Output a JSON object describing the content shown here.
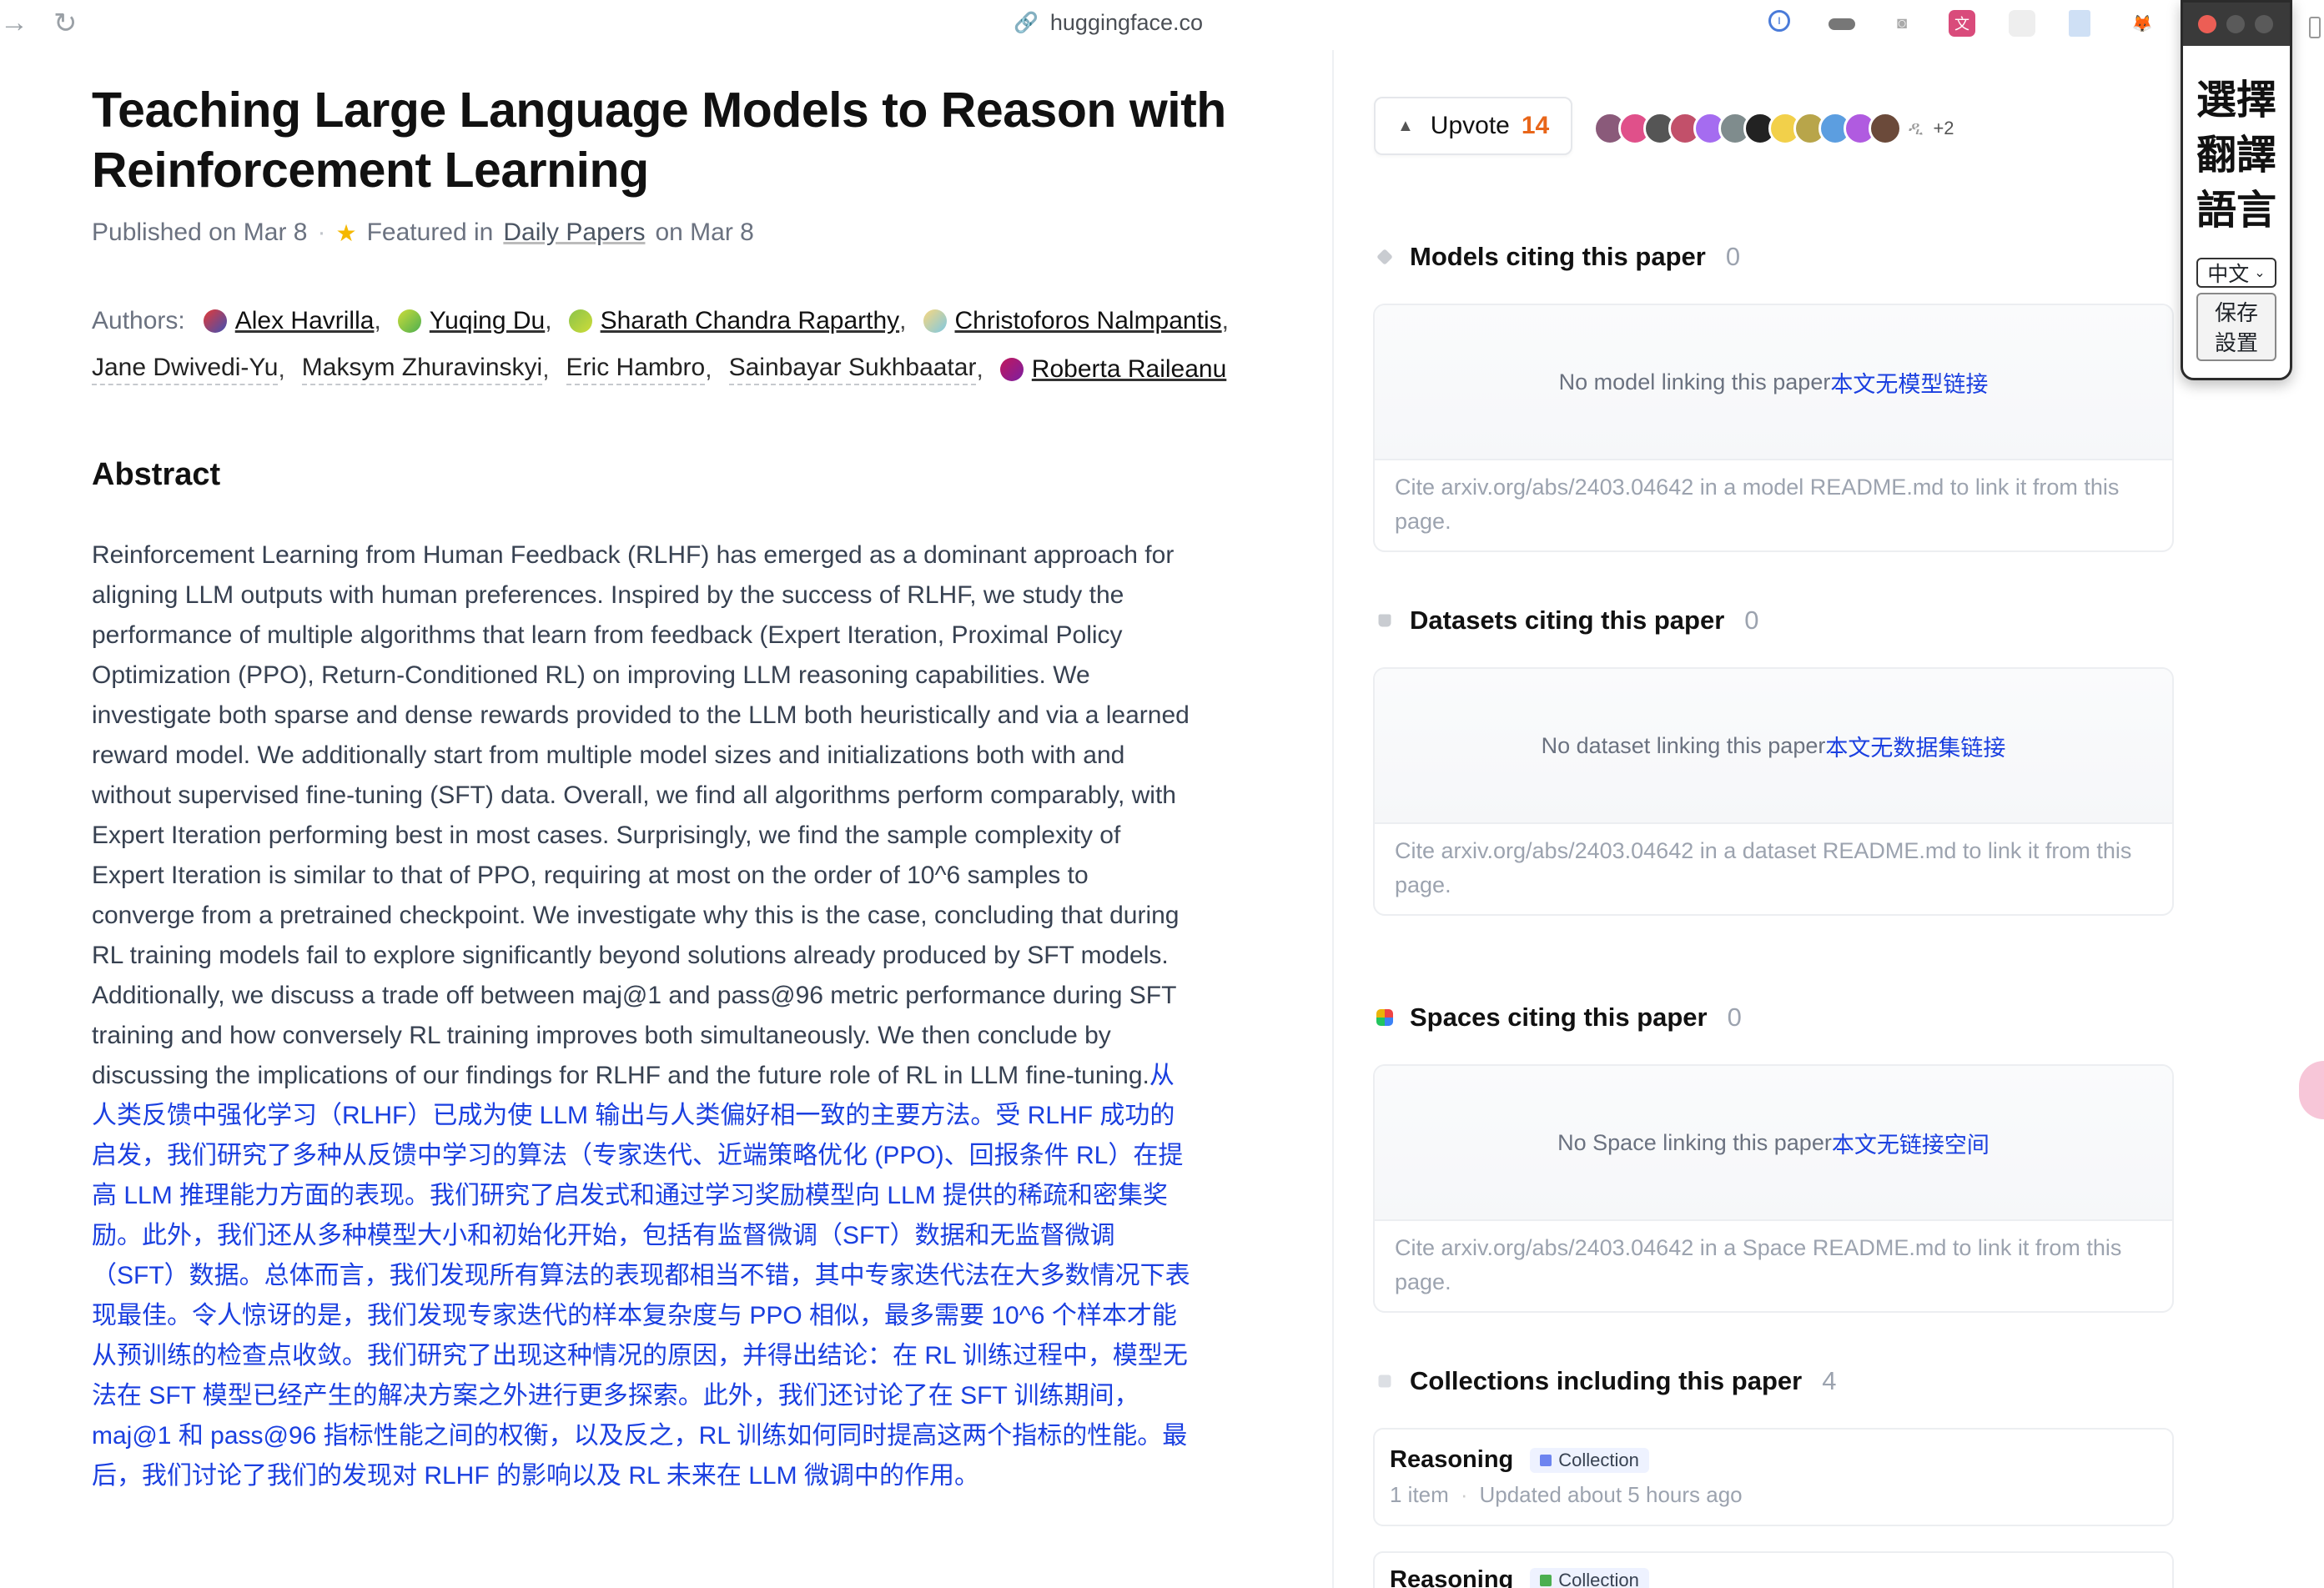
{
  "browser": {
    "url": "huggingface.co",
    "back_icon": "arrow-right-icon",
    "reload_icon": "reload-icon"
  },
  "paper": {
    "title": "Teaching Large Language Models to Reason with Reinforcement Learning",
    "published": "Published on Mar 8",
    "featured_prefix": "Featured in",
    "featured_link": "Daily Papers",
    "featured_suffix": "on Mar 8",
    "authors_label": "Authors:",
    "authors": [
      {
        "name": "Alex Havrilla",
        "linked": true,
        "color": "#5b6ef5"
      },
      {
        "name": "Yuqing Du",
        "linked": true,
        "color": "#8bc34a"
      },
      {
        "name": "Sharath Chandra Raparthy",
        "linked": true,
        "color": "#9ccc65"
      },
      {
        "name": "Christoforos Nalmpantis",
        "linked": true,
        "color": "#7ec8e3"
      },
      {
        "name": "Jane Dwivedi-Yu",
        "linked": false
      },
      {
        "name": "Maksym Zhuravinskyi",
        "linked": false
      },
      {
        "name": "Eric Hambro",
        "linked": false
      },
      {
        "name": "Sainbayar Sukhbaatar",
        "linked": false
      },
      {
        "name": "Roberta Raileanu",
        "linked": true,
        "color": "#c2185b"
      }
    ],
    "abstract_heading": "Abstract",
    "abstract_en": "Reinforcement Learning from Human Feedback (RLHF) has emerged as a dominant approach for aligning LLM outputs with human preferences. Inspired by the success of RLHF, we study the performance of multiple algorithms that learn from feedback (Expert Iteration, Proximal Policy Optimization (PPO), Return-Conditioned RL) on improving LLM reasoning capabilities. We investigate both sparse and dense rewards provided to the LLM both heuristically and via a learned reward model. We additionally start from multiple model sizes and initializations both with and without supervised fine-tuning (SFT) data. Overall, we find all algorithms perform comparably, with Expert Iteration performing best in most cases. Surprisingly, we find the sample complexity of Expert Iteration is similar to that of PPO, requiring at most on the order of 10^6 samples to converge from a pretrained checkpoint. We investigate why this is the case, concluding that during RL training models fail to explore significantly beyond solutions already produced by SFT models. Additionally, we discuss a trade off between maj@1 and pass@96 metric performance during SFT training and how conversely RL training improves both simultaneously. We then conclude by discussing the implications of our findings for RLHF and the future role of RL in LLM fine-tuning.",
    "abstract_zh": "从人类反馈中强化学习（RLHF）已成为使 LLM 输出与人类偏好相一致的主要方法。受 RLHF 成功的启发，我们研究了多种从反馈中学习的算法（专家迭代、近端策略优化 (PPO)、回报条件 RL）在提高 LLM 推理能力方面的表现。我们研究了启发式和通过学习奖励模型向 LLM 提供的稀疏和密集奖励。此外，我们还从多种模型大小和初始化开始，包括有监督微调（SFT）数据和无监督微调（SFT）数据。总体而言，我们发现所有算法的表现都相当不错，其中专家迭代法在大多数情况下表现最佳。令人惊讶的是，我们发现专家迭代的样本复杂度与 PPO 相似，最多需要 10^6 个样本才能从预训练的检查点收敛。我们研究了出现这种情况的原因，并得出结论：在 RL 训练过程中，模型无法在 SFT 模型已经产生的解决方案之外进行更多探索。此外，我们还讨论了在 SFT 训练期间，maj@1 和 pass@96 指标性能之间的权衡，以及反之，RL 训练如何同时提高这两个指标的性能。最后，我们讨论了我们的发现对 RLHF 的影响以及 RL 未来在 LLM 微调中的作用。"
  },
  "sidebar": {
    "upvote_label": "Upvote",
    "upvote_count": "14",
    "extra_upvoters": "+2",
    "models": {
      "heading": "Models citing this paper",
      "count": "0",
      "empty": "No model linking this paper",
      "empty_zh": "本文无模型链接",
      "cite": "Cite arxiv.org/abs/2403.04642 in a model README.md to link it from this page."
    },
    "datasets": {
      "heading": "Datasets citing this paper",
      "count": "0",
      "empty": "No dataset linking this paper",
      "empty_zh": "本文无数据集链接",
      "cite": "Cite arxiv.org/abs/2403.04642 in a dataset README.md to link it from this page."
    },
    "spaces": {
      "heading": "Spaces citing this paper",
      "count": "0",
      "empty": "No Space linking this paper",
      "empty_zh": "本文无链接空间",
      "cite": "Cite arxiv.org/abs/2403.04642 in a Space README.md to link it from this page."
    },
    "collections": {
      "heading": "Collections including this paper",
      "count": "4",
      "items": [
        {
          "name": "Reasoning",
          "badge": "Collection",
          "items_count": "1 item",
          "updated": "Updated about 5 hours ago"
        },
        {
          "name": "Reasoning",
          "badge": "Collection",
          "items_count": "",
          "updated": ""
        }
      ]
    }
  },
  "widget": {
    "title_line1": "選擇",
    "title_line2": "翻譯",
    "title_line3": "語言",
    "language": "中文",
    "save_line1": "保存",
    "save_line2": "設置"
  }
}
